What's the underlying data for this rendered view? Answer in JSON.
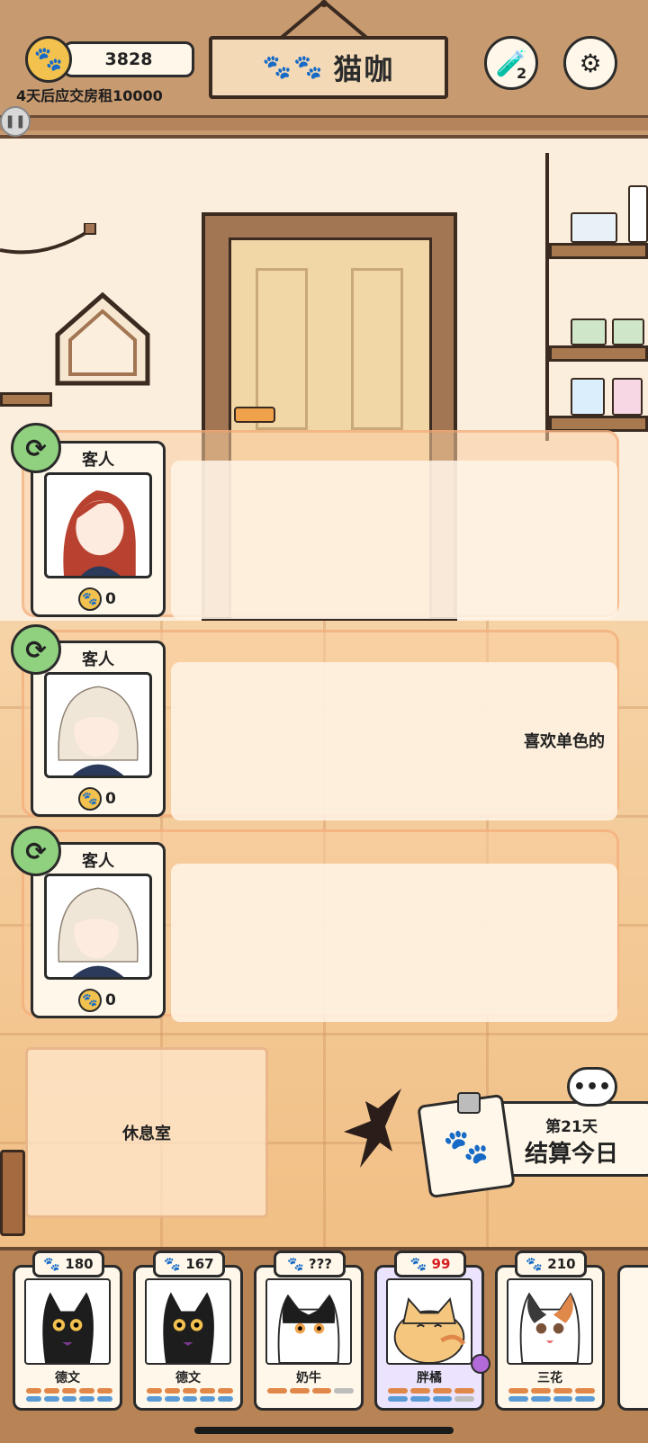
{
  "header": {
    "coins": "3828",
    "rent_notice": "4天后应交房租10000",
    "title": "猫咖",
    "potion_count": "2"
  },
  "customers": [
    {
      "title": "客人",
      "coins": "0",
      "request": ""
    },
    {
      "title": "客人",
      "coins": "0",
      "request": "喜欢单色的"
    },
    {
      "title": "客人",
      "coins": "0",
      "request": ""
    }
  ],
  "rest_room": {
    "label": "休息室"
  },
  "settle": {
    "day": "第21天",
    "label": "结算今日"
  },
  "cats": [
    {
      "name": "德文",
      "score": "180",
      "special": false
    },
    {
      "name": "德文",
      "score": "167",
      "special": false
    },
    {
      "name": "奶牛",
      "score": "???",
      "special": false
    },
    {
      "name": "胖橘",
      "score": "99",
      "special": true
    },
    {
      "name": "三花",
      "score": "210",
      "special": false
    }
  ],
  "colors": {
    "accent_orange": "#e0884a",
    "accent_blue": "#5b9bd5",
    "refresh_green": "#8fd17f",
    "coin_yellow": "#f2c14e"
  }
}
